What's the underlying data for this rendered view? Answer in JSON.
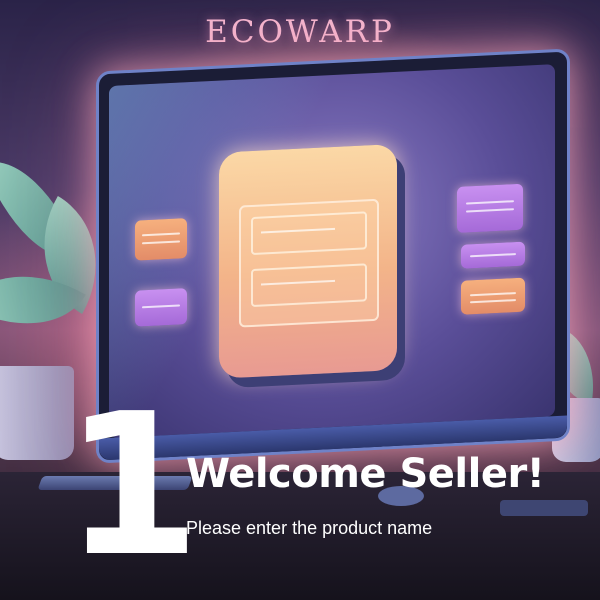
{
  "brand": {
    "name": "ECOWARP"
  },
  "step": {
    "number": "1",
    "heading": "Welcome Seller!",
    "prompt": "Please enter the product name"
  },
  "colors": {
    "brand_text": "#f3b7cf",
    "heading_text": "#ffffff",
    "card_orange": "#f6b07e",
    "card_violet": "#c890f0",
    "window_peach": "#fbd8a6"
  }
}
